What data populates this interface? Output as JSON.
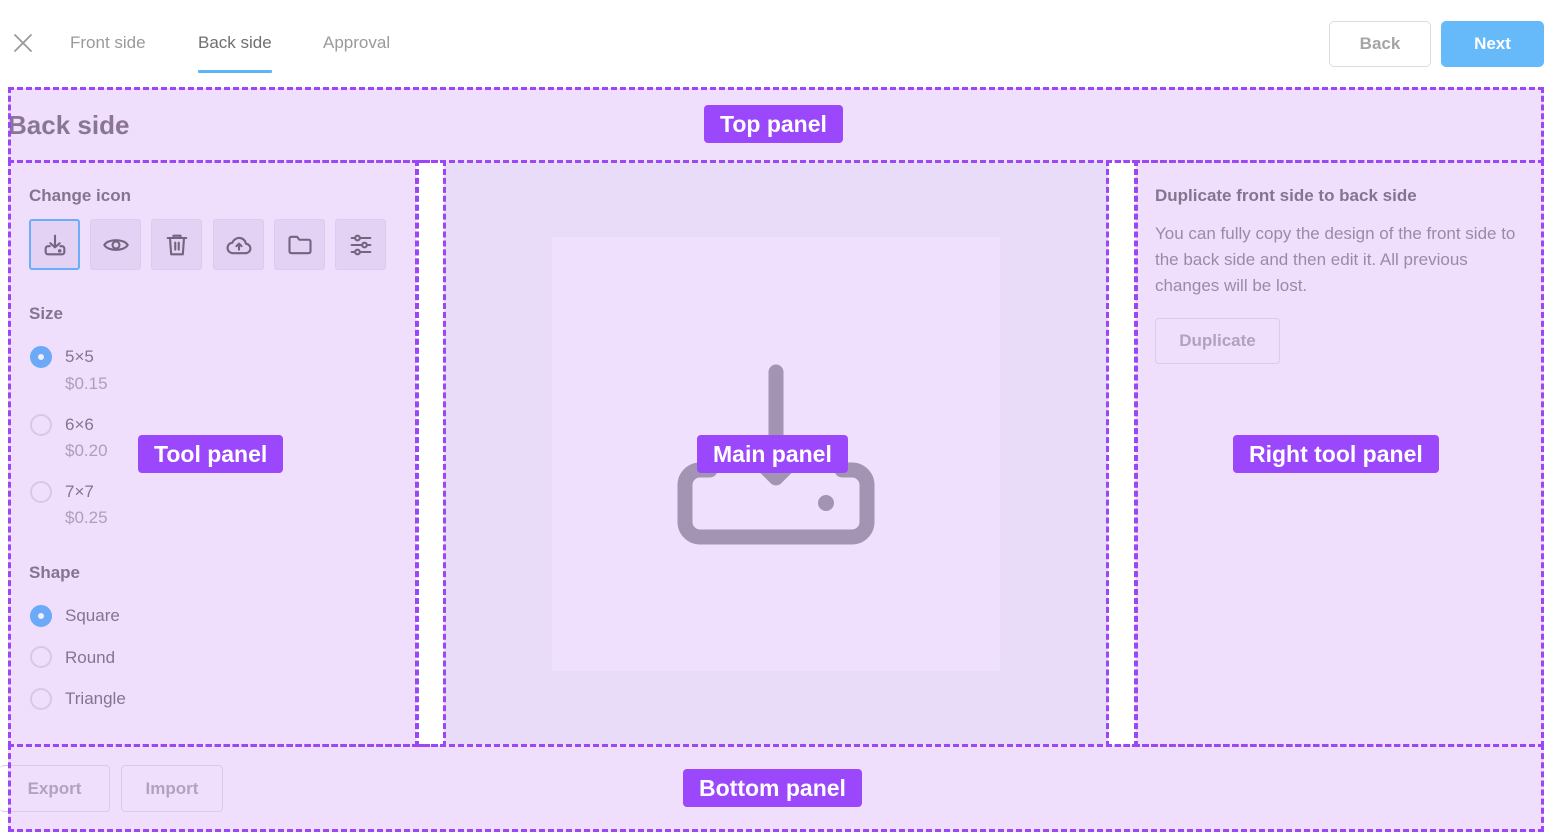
{
  "header": {
    "close_icon": "close-icon",
    "tabs": [
      {
        "label": "Front side",
        "active": false
      },
      {
        "label": "Back side",
        "active": true
      },
      {
        "label": "Approval",
        "active": false
      }
    ],
    "back_label": "Back",
    "next_label": "Next"
  },
  "colors": {
    "accent": "#67baf9",
    "overlay": "#efdffd",
    "overlay_border": "#9b47f5",
    "tag": "#9b47fb"
  },
  "overlay_labels": {
    "top": "Top panel",
    "tool": "Tool panel",
    "main": "Main panel",
    "right": "Right tool panel",
    "bottom": "Bottom panel"
  },
  "page": {
    "title": "Back side"
  },
  "tool_panel": {
    "change_icon_label": "Change icon",
    "icons": [
      {
        "name": "download-tray-icon",
        "selected": true
      },
      {
        "name": "eye-icon",
        "selected": false
      },
      {
        "name": "trash-icon",
        "selected": false
      },
      {
        "name": "cloud-upload-icon",
        "selected": false
      },
      {
        "name": "folder-icon",
        "selected": false
      },
      {
        "name": "sliders-icon",
        "selected": false
      }
    ],
    "size_label": "Size",
    "sizes": [
      {
        "label": "5×5",
        "price": "$0.15",
        "checked": true
      },
      {
        "label": "6×6",
        "price": "$0.20",
        "checked": false
      },
      {
        "label": "7×7",
        "price": "$0.25",
        "checked": false
      }
    ],
    "shape_label": "Shape",
    "shapes": [
      {
        "label": "Square",
        "checked": true
      },
      {
        "label": "Round",
        "checked": false
      },
      {
        "label": "Triangle",
        "checked": false
      }
    ]
  },
  "main_panel": {
    "preview_icon": "download-tray-icon"
  },
  "right_panel": {
    "title": "Duplicate front side to back side",
    "description": "You can fully copy the design of the front side to the back side and then edit it. All previous changes will be lost.",
    "duplicate_label": "Duplicate"
  },
  "bottom_panel": {
    "export_label": "Export",
    "import_label": "Import"
  }
}
